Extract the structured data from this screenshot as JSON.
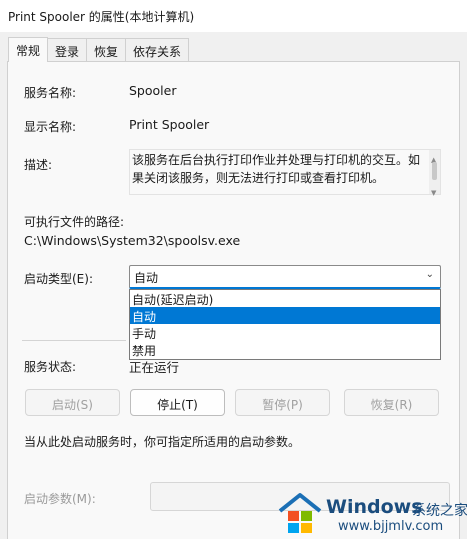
{
  "window": {
    "title": "Print Spooler 的属性(本地计算机)"
  },
  "tabs": [
    {
      "label": "常规",
      "active": true
    },
    {
      "label": "登录"
    },
    {
      "label": "恢复"
    },
    {
      "label": "依存关系"
    }
  ],
  "general": {
    "service_name_label": "服务名称:",
    "service_name_value": "Spooler",
    "display_name_label": "显示名称:",
    "display_name_value": "Print Spooler",
    "description_label": "描述:",
    "description_value": "该服务在后台执行打印作业并处理与打印机的交互。如果关闭该服务，则无法进行打印或查看打印机。",
    "exe_path_label": "可执行文件的路径:",
    "exe_path_value": "C:\\Windows\\System32\\spoolsv.exe",
    "startup_type_label": "启动类型(E):",
    "startup_type_value": "自动",
    "startup_type_options": [
      "自动(延迟启动)",
      "自动",
      "手动",
      "禁用"
    ],
    "startup_type_selected_index": 1,
    "service_status_label": "服务状态:",
    "service_status_value": "正在运行",
    "buttons": {
      "start": "启动(S)",
      "stop": "停止(T)",
      "pause": "暂停(P)",
      "resume": "恢复(R)"
    },
    "hint": "当从此处启动服务时，你可指定所适用的启动参数。",
    "start_params_label": "启动参数(M):",
    "start_params_value": ""
  },
  "watermark": {
    "brand": "Windows",
    "brand_cn": "系统之家",
    "url": "www.bjjmlv.com",
    "colors": [
      "#1b4d7e",
      "#f25022",
      "#7fba00",
      "#00a4ef",
      "#ffb900"
    ]
  }
}
